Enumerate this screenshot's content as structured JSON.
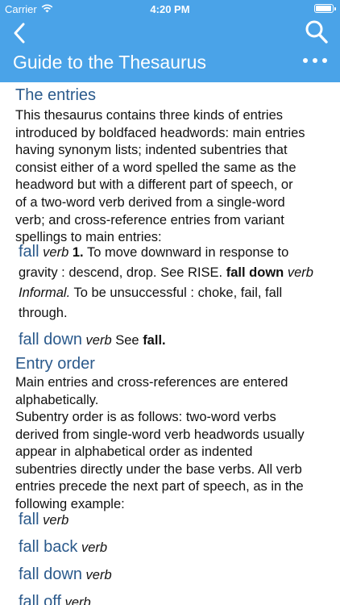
{
  "status_bar": {
    "carrier": "Carrier",
    "time": "4:20 PM"
  },
  "nav": {
    "title": "Guide to the Thesaurus",
    "back_icon": "chevron-left-icon",
    "search_icon": "search-icon",
    "more_icon": "more-icon"
  },
  "colors": {
    "header_bg": "#4aa3e8",
    "heading": "#2b5a8c"
  },
  "sections": {
    "entries": {
      "heading": "The entries",
      "paragraph_lines": [
        "This thesaurus contains three kinds of entries",
        "introduced by boldfaced headwords: main entries",
        "having synonym lists; indented subentries that",
        "consist either of a word spelled the same as the",
        "headword but with a different part of speech, or",
        "of a two-word verb derived from a single-word",
        "verb; and cross-reference entries from variant",
        "spellings to main entries:"
      ],
      "example_entry": {
        "headword": "fall",
        "pos": "verb",
        "sense_number": "1.",
        "line1_text": "To move downward in response to",
        "line2_text": "gravity : descend, drop. See RISE.",
        "sub_headword": "fall down",
        "sub_pos": "verb",
        "label": "Informal.",
        "line3_text": "To be unsuccessful : choke, fail, fall",
        "line4_text": "through."
      },
      "xref_entry": {
        "headword": "fall down",
        "pos": "verb",
        "see": "See",
        "target": "fall."
      }
    },
    "order": {
      "heading": "Entry order",
      "paragraph1_lines": [
        "Main entries and cross-references are entered",
        "alphabetically."
      ],
      "paragraph2_lines": [
        "Subentry order is as follows: two-word verbs",
        "derived from single-word verb headwords usually",
        "appear in alphabetical order as indented",
        "subentries directly under the base verbs. All verb",
        "entries precede the next part of speech, as in the",
        "following example:"
      ],
      "examples": [
        {
          "headword": "fall",
          "pos": "verb"
        },
        {
          "headword": "fall back",
          "pos": "verb"
        },
        {
          "headword": "fall down",
          "pos": "verb"
        },
        {
          "headword": "fall off",
          "pos": "verb"
        }
      ]
    }
  }
}
